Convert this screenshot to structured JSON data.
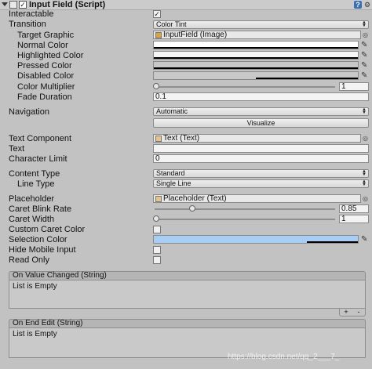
{
  "header": {
    "title": "Input Field (Script)",
    "enabled": "✓",
    "help": "?",
    "gear": "⚙"
  },
  "interactable": {
    "label": "Interactable",
    "checked": "✓"
  },
  "transition": {
    "label": "Transition",
    "value": "Color Tint"
  },
  "target_graphic": {
    "label": "Target Graphic",
    "value": "InputField (Image)"
  },
  "normal_color": {
    "label": "Normal Color"
  },
  "highlighted_color": {
    "label": "Highlighted Color"
  },
  "pressed_color": {
    "label": "Pressed Color"
  },
  "disabled_color": {
    "label": "Disabled Color"
  },
  "color_multiplier": {
    "label": "Color Multiplier",
    "value": "1"
  },
  "fade_duration": {
    "label": "Fade Duration",
    "value": "0.1"
  },
  "navigation": {
    "label": "Navigation",
    "value": "Automatic",
    "visualize": "Visualize"
  },
  "text_component": {
    "label": "Text Component",
    "value": "Text (Text)"
  },
  "text": {
    "label": "Text",
    "value": ""
  },
  "character_limit": {
    "label": "Character Limit",
    "value": "0"
  },
  "content_type": {
    "label": "Content Type",
    "value": "Standard"
  },
  "line_type": {
    "label": "Line Type",
    "value": "Single Line"
  },
  "placeholder": {
    "label": "Placeholder",
    "value": "Placeholder (Text)"
  },
  "caret_blink_rate": {
    "label": "Caret Blink Rate",
    "value": "0.85"
  },
  "caret_width": {
    "label": "Caret Width",
    "value": "1"
  },
  "custom_caret_color": {
    "label": "Custom Caret Color"
  },
  "selection_color": {
    "label": "Selection Color",
    "color": "#a8cef5"
  },
  "hide_mobile_input": {
    "label": "Hide Mobile Input"
  },
  "read_only": {
    "label": "Read Only"
  },
  "on_value_changed": {
    "title": "On Value Changed (String)",
    "empty": "List is Empty",
    "add": "+",
    "remove": "-"
  },
  "on_end_edit": {
    "title": "On End Edit (String)",
    "empty": "List is Empty"
  },
  "watermark": "https://blog.csdn.net/qq_2___7_"
}
